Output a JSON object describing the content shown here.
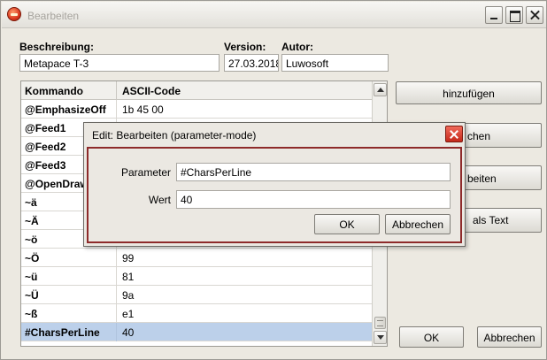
{
  "window": {
    "title": "Bearbeiten"
  },
  "header": {
    "beschreibung_label": "Beschreibung:",
    "beschreibung_value": "Metapace T-3",
    "version_label": "Version:",
    "version_value": "27.03.2018",
    "autor_label": "Autor:",
    "autor_value": "Luwosoft"
  },
  "table": {
    "columns": [
      "Kommando",
      "ASCII-Code"
    ],
    "rows": [
      [
        "@EmphasizeOff",
        "1b 45 00"
      ],
      [
        "@Feed1",
        ""
      ],
      [
        "@Feed2",
        ""
      ],
      [
        "@Feed3",
        ""
      ],
      [
        "@OpenDraw",
        ""
      ],
      [
        "~ä",
        ""
      ],
      [
        "~Ä",
        ""
      ],
      [
        "~ö",
        ""
      ],
      [
        "~Ö",
        "99"
      ],
      [
        "~ü",
        "81"
      ],
      [
        "~Ü",
        "9a"
      ],
      [
        "~ß",
        "e1"
      ],
      [
        "#CharsPerLine",
        "40"
      ]
    ],
    "selected_row": 12
  },
  "side_buttons": {
    "hinzufuegen": "hinzufügen",
    "partial2": "chen",
    "partial3": "beiten",
    "partial4": "als Text"
  },
  "footer": {
    "ok": "OK",
    "abbrechen": "Abbrechen"
  },
  "dialog": {
    "title": "Edit:  Bearbeiten  (parameter-mode)",
    "parameter_label": "Parameter",
    "parameter_value": "#CharsPerLine",
    "wert_label": "Wert",
    "wert_value": "40",
    "ok": "OK",
    "abbrechen": "Abbrechen"
  },
  "colors": {
    "selection": "#bcd0ea",
    "dialog_border": "#8e2a2a",
    "close_red": "#d43a2a"
  }
}
